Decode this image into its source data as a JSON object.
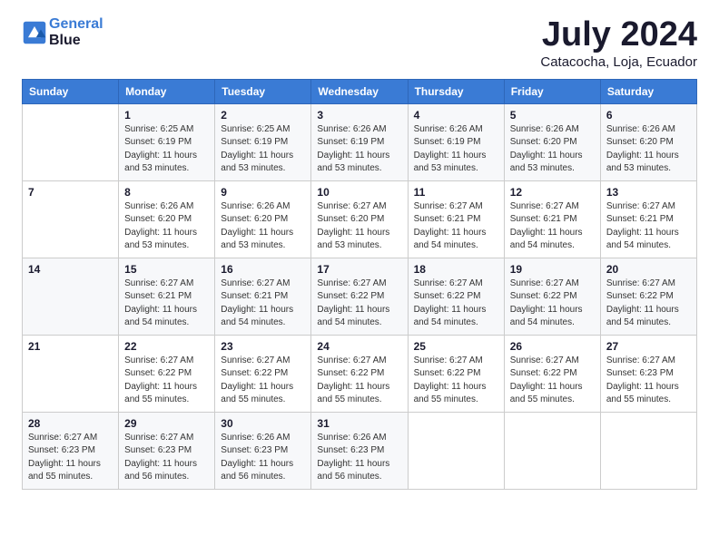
{
  "header": {
    "logo_line1": "General",
    "logo_line2": "Blue",
    "month_title": "July 2024",
    "location": "Catacocha, Loja, Ecuador"
  },
  "weekdays": [
    "Sunday",
    "Monday",
    "Tuesday",
    "Wednesday",
    "Thursday",
    "Friday",
    "Saturday"
  ],
  "weeks": [
    [
      {
        "day": "",
        "info": ""
      },
      {
        "day": "1",
        "info": "Sunrise: 6:25 AM\nSunset: 6:19 PM\nDaylight: 11 hours\nand 53 minutes."
      },
      {
        "day": "2",
        "info": "Sunrise: 6:25 AM\nSunset: 6:19 PM\nDaylight: 11 hours\nand 53 minutes."
      },
      {
        "day": "3",
        "info": "Sunrise: 6:26 AM\nSunset: 6:19 PM\nDaylight: 11 hours\nand 53 minutes."
      },
      {
        "day": "4",
        "info": "Sunrise: 6:26 AM\nSunset: 6:19 PM\nDaylight: 11 hours\nand 53 minutes."
      },
      {
        "day": "5",
        "info": "Sunrise: 6:26 AM\nSunset: 6:20 PM\nDaylight: 11 hours\nand 53 minutes."
      },
      {
        "day": "6",
        "info": "Sunrise: 6:26 AM\nSunset: 6:20 PM\nDaylight: 11 hours\nand 53 minutes."
      }
    ],
    [
      {
        "day": "7",
        "info": ""
      },
      {
        "day": "8",
        "info": "Sunrise: 6:26 AM\nSunset: 6:20 PM\nDaylight: 11 hours\nand 53 minutes."
      },
      {
        "day": "9",
        "info": "Sunrise: 6:26 AM\nSunset: 6:20 PM\nDaylight: 11 hours\nand 53 minutes."
      },
      {
        "day": "10",
        "info": "Sunrise: 6:27 AM\nSunset: 6:20 PM\nDaylight: 11 hours\nand 53 minutes."
      },
      {
        "day": "11",
        "info": "Sunrise: 6:27 AM\nSunset: 6:21 PM\nDaylight: 11 hours\nand 54 minutes."
      },
      {
        "day": "12",
        "info": "Sunrise: 6:27 AM\nSunset: 6:21 PM\nDaylight: 11 hours\nand 54 minutes."
      },
      {
        "day": "13",
        "info": "Sunrise: 6:27 AM\nSunset: 6:21 PM\nDaylight: 11 hours\nand 54 minutes."
      }
    ],
    [
      {
        "day": "14",
        "info": ""
      },
      {
        "day": "15",
        "info": "Sunrise: 6:27 AM\nSunset: 6:21 PM\nDaylight: 11 hours\nand 54 minutes."
      },
      {
        "day": "16",
        "info": "Sunrise: 6:27 AM\nSunset: 6:21 PM\nDaylight: 11 hours\nand 54 minutes."
      },
      {
        "day": "17",
        "info": "Sunrise: 6:27 AM\nSunset: 6:22 PM\nDaylight: 11 hours\nand 54 minutes."
      },
      {
        "day": "18",
        "info": "Sunrise: 6:27 AM\nSunset: 6:22 PM\nDaylight: 11 hours\nand 54 minutes."
      },
      {
        "day": "19",
        "info": "Sunrise: 6:27 AM\nSunset: 6:22 PM\nDaylight: 11 hours\nand 54 minutes."
      },
      {
        "day": "20",
        "info": "Sunrise: 6:27 AM\nSunset: 6:22 PM\nDaylight: 11 hours\nand 54 minutes."
      }
    ],
    [
      {
        "day": "21",
        "info": ""
      },
      {
        "day": "22",
        "info": "Sunrise: 6:27 AM\nSunset: 6:22 PM\nDaylight: 11 hours\nand 55 minutes."
      },
      {
        "day": "23",
        "info": "Sunrise: 6:27 AM\nSunset: 6:22 PM\nDaylight: 11 hours\nand 55 minutes."
      },
      {
        "day": "24",
        "info": "Sunrise: 6:27 AM\nSunset: 6:22 PM\nDaylight: 11 hours\nand 55 minutes."
      },
      {
        "day": "25",
        "info": "Sunrise: 6:27 AM\nSunset: 6:22 PM\nDaylight: 11 hours\nand 55 minutes."
      },
      {
        "day": "26",
        "info": "Sunrise: 6:27 AM\nSunset: 6:22 PM\nDaylight: 11 hours\nand 55 minutes."
      },
      {
        "day": "27",
        "info": "Sunrise: 6:27 AM\nSunset: 6:23 PM\nDaylight: 11 hours\nand 55 minutes."
      }
    ],
    [
      {
        "day": "28",
        "info": "Sunrise: 6:27 AM\nSunset: 6:23 PM\nDaylight: 11 hours\nand 55 minutes."
      },
      {
        "day": "29",
        "info": "Sunrise: 6:27 AM\nSunset: 6:23 PM\nDaylight: 11 hours\nand 56 minutes."
      },
      {
        "day": "30",
        "info": "Sunrise: 6:26 AM\nSunset: 6:23 PM\nDaylight: 11 hours\nand 56 minutes."
      },
      {
        "day": "31",
        "info": "Sunrise: 6:26 AM\nSunset: 6:23 PM\nDaylight: 11 hours\nand 56 minutes."
      },
      {
        "day": "",
        "info": ""
      },
      {
        "day": "",
        "info": ""
      },
      {
        "day": "",
        "info": ""
      }
    ]
  ]
}
